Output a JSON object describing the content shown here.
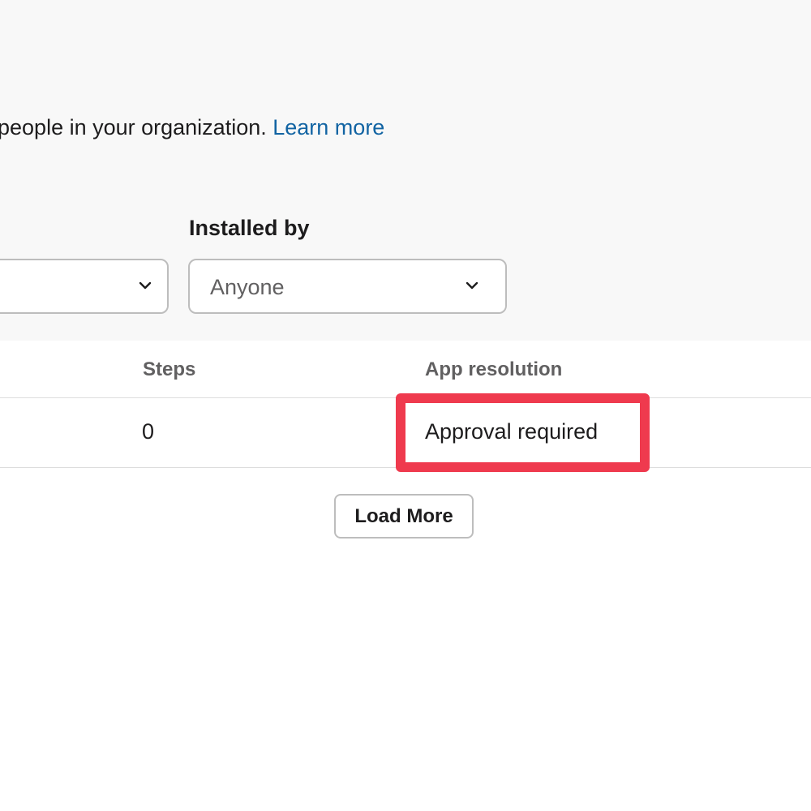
{
  "filters": {
    "description_text": "people in your organization.",
    "learn_more_link": "Learn more",
    "installed_by_label": "Installed by",
    "installed_by_value": "Anyone",
    "left_select_value": ""
  },
  "table": {
    "columns": [
      "Steps",
      "App resolution"
    ],
    "rows": [
      {
        "steps": "0",
        "app_resolution": "Approval required"
      }
    ]
  },
  "actions": {
    "load_more_label": "Load More"
  },
  "icons": {
    "select_chevron": "chevron-down-icon"
  },
  "colors": {
    "highlight": "#ef3a4e",
    "link": "#1264a3",
    "panel_background": "#f8f8f8"
  }
}
